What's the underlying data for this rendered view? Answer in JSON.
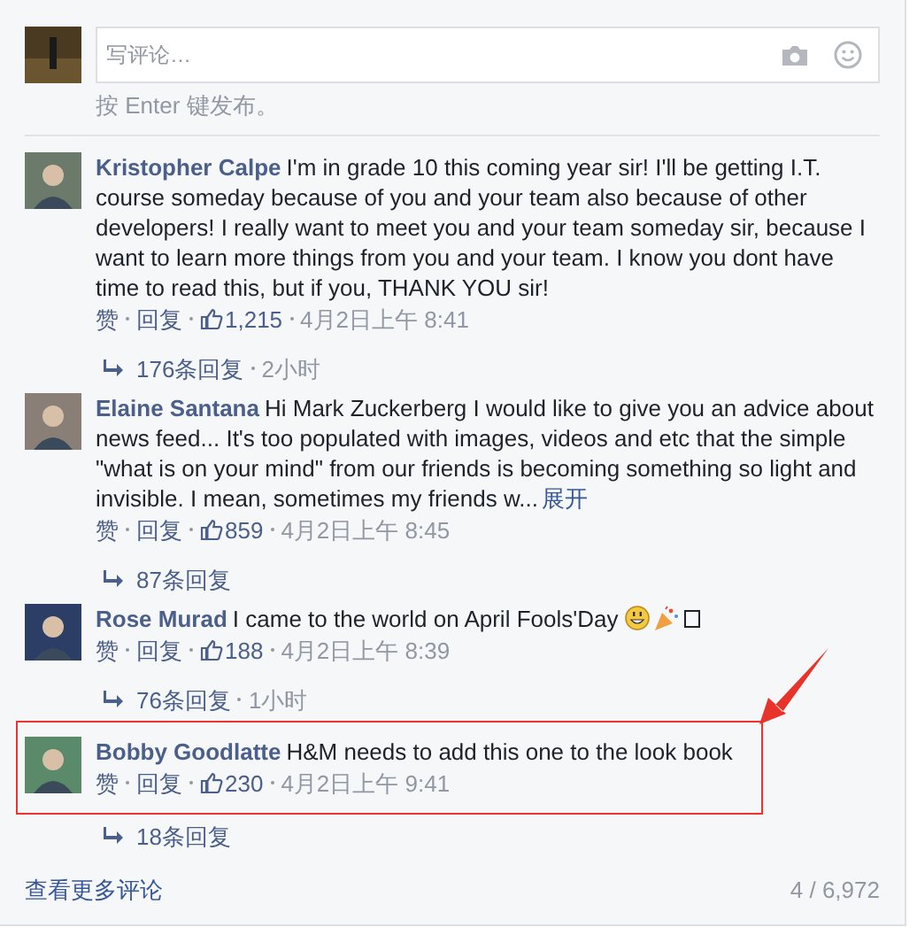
{
  "composer": {
    "placeholder": "写评论…",
    "hint": "按 Enter 键发布。"
  },
  "comments": [
    {
      "author": "Kristopher Calpe",
      "text": "I'm in grade 10 this coming year sir! I'll be getting I.T. course someday because of you and your team also because of other developers! I really want to meet you and your team someday sir, because I want to learn more things from you and your team. I know you dont have time to read this, but if you, THANK YOU sir!",
      "like": "赞",
      "reply": "回复",
      "likes": "1,215",
      "time": "4月2日上午 8:41",
      "replies": "176条回复",
      "replies_time": "2小时",
      "highlighted": false
    },
    {
      "author": "Elaine Santana",
      "text": "Hi Mark Zuckerberg I would like to give you an advice about news feed... It's too populated with images, videos and etc that the simple \"what is on your mind\" from our friends is becoming something so light and invisible. I mean, sometimes my friends w...",
      "more": "展开",
      "like": "赞",
      "reply": "回复",
      "likes": "859",
      "time": "4月2日上午 8:45",
      "replies": "87条回复",
      "highlighted": false
    },
    {
      "author": "Rose Murad",
      "text": "I came to the world on April Fools'Day",
      "emoji": true,
      "like": "赞",
      "reply": "回复",
      "likes": "188",
      "time": "4月2日上午 8:39",
      "replies": "76条回复",
      "replies_time": "1小时",
      "highlighted": false
    },
    {
      "author": "Bobby Goodlatte",
      "text": "H&M needs to add this one to the look book",
      "like": "赞",
      "reply": "回复",
      "likes": "230",
      "time": "4月2日上午 9:41",
      "replies": "18条回复",
      "highlighted": true
    }
  ],
  "footer": {
    "more_link": "查看更多评论",
    "count": "4 / 6,972"
  }
}
